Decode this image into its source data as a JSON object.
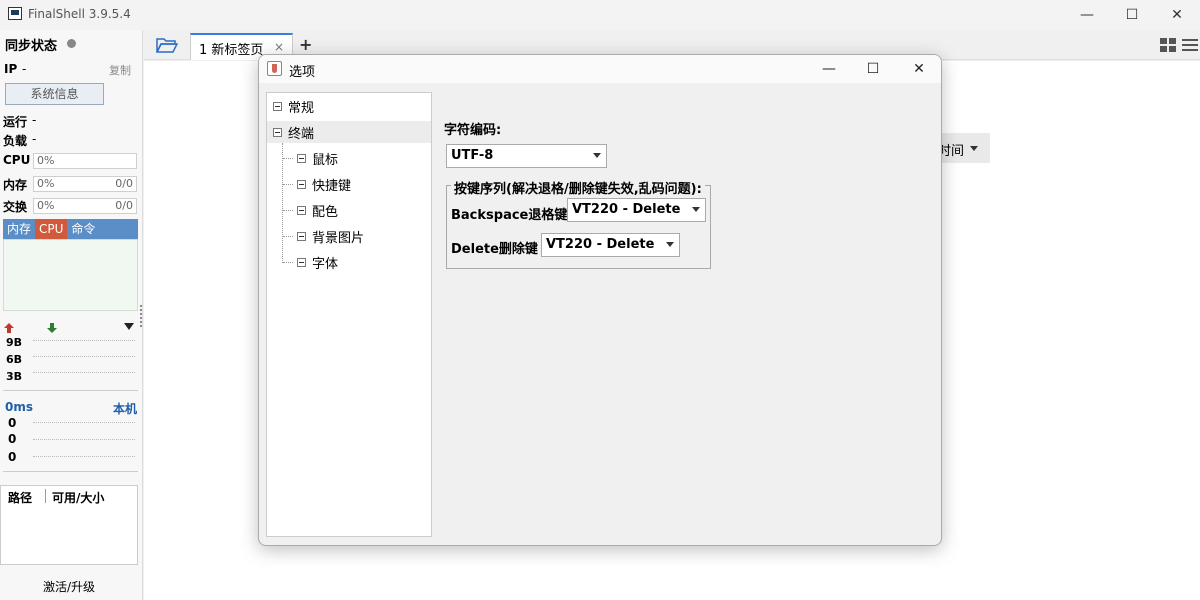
{
  "app": {
    "title": "FinalShell 3.9.5.4",
    "win_min": "—",
    "win_max": "☐",
    "win_close": "✕"
  },
  "left": {
    "sync_status": "同步状态",
    "ip_label": "IP",
    "ip_value": "-",
    "copy": "复制",
    "sysinfo_btn": "系统信息",
    "run_label": "运行",
    "run_value": "-",
    "load_label": "负载",
    "load_value": "-",
    "cpu_label": "CPU",
    "cpu_value": "0%",
    "mem_label": "内存",
    "mem_value": "0%",
    "mem_extra": "0/0",
    "swap_label": "交换",
    "swap_value": "0%",
    "swap_extra": "0/0",
    "proc_tabs": [
      "内存",
      "CPU",
      "命令"
    ],
    "net_labels": [
      "9B",
      "6B",
      "3B"
    ],
    "ping_value": "0ms",
    "ping_host": "本机",
    "ping_labels": [
      "0",
      "0",
      "0"
    ],
    "disk_path": "路径",
    "disk_avail": "可用/大小",
    "activate": "激活/升级"
  },
  "tabs": {
    "tab1_label": "1 新标签页",
    "tab1_close": "×",
    "add": "+"
  },
  "workspace": {
    "select_fragment": "时间"
  },
  "dialog": {
    "title": "选项",
    "btn_min": "—",
    "btn_max": "☐",
    "btn_close": "✕",
    "tree": {
      "general": "常规",
      "terminal": "终端",
      "children": [
        "鼠标",
        "快捷键",
        "配色",
        "背景图片",
        "字体"
      ]
    },
    "encoding_label": "字符编码:",
    "encoding_value": "UTF-8",
    "group_title": "按键序列(解决退格/删除键失效,乱码问题):",
    "backspace_label": "Backspace退格键",
    "backspace_value": "VT220 - Delete",
    "delete_label": "Delete删除键",
    "delete_value": "VT220 - Delete"
  },
  "colors": {
    "accent": "#3b7ddd",
    "proc_header": "#5b8ec7",
    "cpu_tab": "#d25a3c",
    "net_up": "#c0392b",
    "net_down": "#2e7d32",
    "link": "#1f5fa8"
  }
}
